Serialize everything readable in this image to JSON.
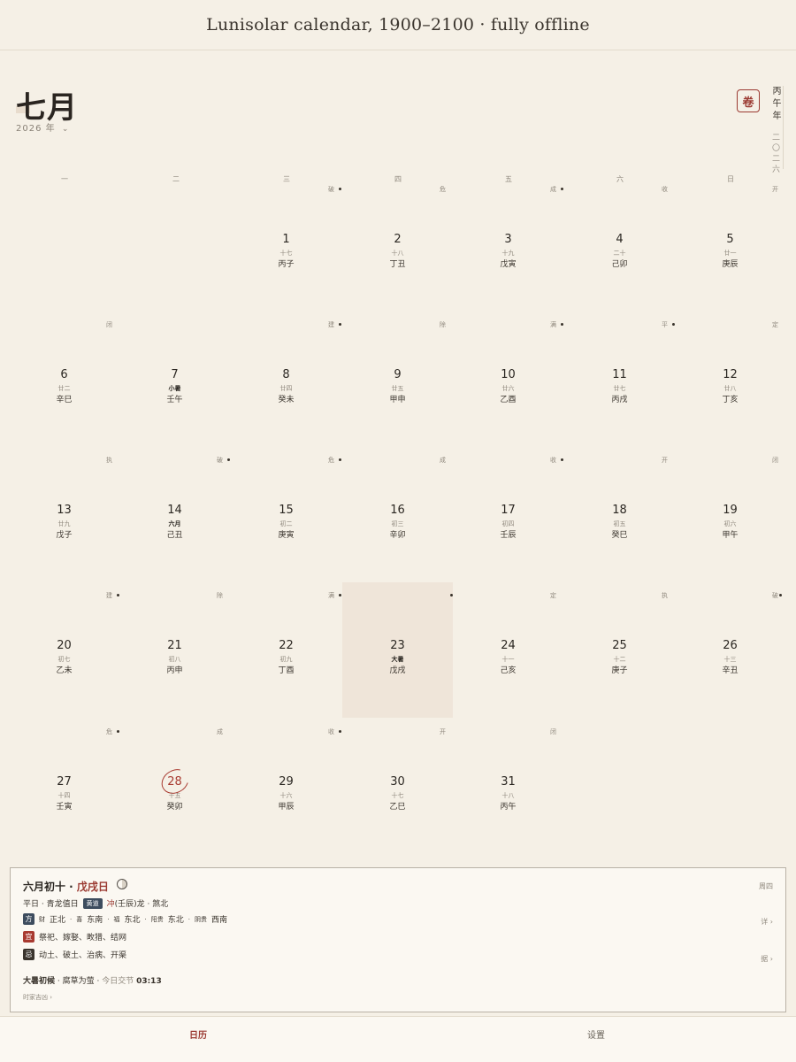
{
  "header": {
    "title": "Lunisolar calendar, 1900–2100 · fully offline"
  },
  "month": {
    "title": "七月",
    "year_label": "2026 年",
    "chevron": "⌄"
  },
  "side": {
    "juan_button": "卷",
    "vertical_year": "丙午年",
    "vertical_year_sub": "二〇二六"
  },
  "weekdays": [
    "一",
    "二",
    "三",
    "四",
    "五",
    "六",
    "日"
  ],
  "days": [
    {
      "d": "1",
      "lunar": "十七",
      "gz": "丙子",
      "jc": "破",
      "dot": true,
      "term": false
    },
    {
      "d": "2",
      "lunar": "十八",
      "gz": "丁丑",
      "jc": "危",
      "dot": false,
      "term": false
    },
    {
      "d": "3",
      "lunar": "十九",
      "gz": "戊寅",
      "jc": "成",
      "dot": true,
      "term": false
    },
    {
      "d": "4",
      "lunar": "二十",
      "gz": "己卯",
      "jc": "收",
      "dot": false,
      "term": false
    },
    {
      "d": "5",
      "lunar": "廿一",
      "gz": "庚辰",
      "jc": "开",
      "dot": false,
      "term": false
    },
    {
      "d": "6",
      "lunar": "廿二",
      "gz": "辛巳",
      "jc": "闭",
      "dot": false,
      "term": false
    },
    {
      "d": "7",
      "lunar": "小暑",
      "gz": "壬午",
      "jc": "",
      "dot": false,
      "term": true
    },
    {
      "d": "8",
      "lunar": "廿四",
      "gz": "癸未",
      "jc": "建",
      "dot": true,
      "term": false
    },
    {
      "d": "9",
      "lunar": "廿五",
      "gz": "甲申",
      "jc": "除",
      "dot": false,
      "term": false
    },
    {
      "d": "10",
      "lunar": "廿六",
      "gz": "乙酉",
      "jc": "满",
      "dot": true,
      "term": false
    },
    {
      "d": "11",
      "lunar": "廿七",
      "gz": "丙戌",
      "jc": "平",
      "dot": true,
      "term": false
    },
    {
      "d": "12",
      "lunar": "廿八",
      "gz": "丁亥",
      "jc": "定",
      "dot": false,
      "term": false
    },
    {
      "d": "13",
      "lunar": "廿九",
      "gz": "戊子",
      "jc": "执",
      "dot": false,
      "term": false
    },
    {
      "d": "14",
      "lunar": "六月",
      "gz": "己丑",
      "jc": "破",
      "dot": true,
      "term": true
    },
    {
      "d": "15",
      "lunar": "初二",
      "gz": "庚寅",
      "jc": "危",
      "dot": true,
      "term": false
    },
    {
      "d": "16",
      "lunar": "初三",
      "gz": "辛卯",
      "jc": "成",
      "dot": false,
      "term": false
    },
    {
      "d": "17",
      "lunar": "初四",
      "gz": "壬辰",
      "jc": "收",
      "dot": true,
      "term": false
    },
    {
      "d": "18",
      "lunar": "初五",
      "gz": "癸巳",
      "jc": "开",
      "dot": false,
      "term": false
    },
    {
      "d": "19",
      "lunar": "初六",
      "gz": "甲午",
      "jc": "闭",
      "dot": false,
      "term": false
    },
    {
      "d": "20",
      "lunar": "初七",
      "gz": "乙未",
      "jc": "建",
      "dot": true,
      "term": false
    },
    {
      "d": "21",
      "lunar": "初八",
      "gz": "丙申",
      "jc": "除",
      "dot": false,
      "term": false
    },
    {
      "d": "22",
      "lunar": "初九",
      "gz": "丁酉",
      "jc": "满",
      "dot": true,
      "term": false
    },
    {
      "d": "23",
      "lunar": "大暑",
      "gz": "戊戌",
      "jc": "",
      "dot": true,
      "term": true,
      "highlight": true
    },
    {
      "d": "24",
      "lunar": "十一",
      "gz": "己亥",
      "jc": "定",
      "dot": false,
      "term": false
    },
    {
      "d": "25",
      "lunar": "十二",
      "gz": "庚子",
      "jc": "执",
      "dot": false,
      "term": false
    },
    {
      "d": "26",
      "lunar": "十三",
      "gz": "辛丑",
      "jc": "破",
      "dot": true,
      "term": false
    },
    {
      "d": "27",
      "lunar": "十四",
      "gz": "壬寅",
      "jc": "危",
      "dot": true,
      "term": false
    },
    {
      "d": "28",
      "lunar": "十五",
      "gz": "癸卯",
      "jc": "成",
      "dot": false,
      "term": false,
      "today": true
    },
    {
      "d": "29",
      "lunar": "十六",
      "gz": "甲辰",
      "jc": "收",
      "dot": true,
      "term": false
    },
    {
      "d": "30",
      "lunar": "十七",
      "gz": "乙巳",
      "jc": "开",
      "dot": false,
      "term": false
    },
    {
      "d": "31",
      "lunar": "十八",
      "gz": "丙午",
      "jc": "闭",
      "dot": false,
      "term": false
    }
  ],
  "detail": {
    "title_prefix": "六月初十 · ",
    "title_gz": "戊戌日",
    "weekday": "周四",
    "day_type": "平日 · 青龙值日",
    "huangdao": "黄道",
    "chong": "冲",
    "chong_rest": "(壬辰)龙 · 煞北",
    "fang_badge": "方",
    "cai_label": "财",
    "cai_val": "正北",
    "xi_label": "喜",
    "xi_val": "东南",
    "fu_label": "福",
    "fu_val": "东北",
    "yang_label": "阳贵",
    "yang_val": "东北",
    "yin_label": "阴贵",
    "yin_val": "西南",
    "detail_link": "详 ›",
    "yi_badge": "宜",
    "yi_text": "祭祀、嫁娶、畋猎、结网",
    "ji_badge": "忌",
    "ji_text": "动土、破土、治病、开渠",
    "ju_link": "据 ›",
    "hou_title": "大暑初候",
    "hou_text": " · 腐草为萤 · ",
    "hou_muted": "今日交节 ",
    "hou_time": "03:13",
    "shichen_link": "时家吉凶 ›"
  },
  "tabs": {
    "calendar": "日历",
    "settings": "设置"
  }
}
